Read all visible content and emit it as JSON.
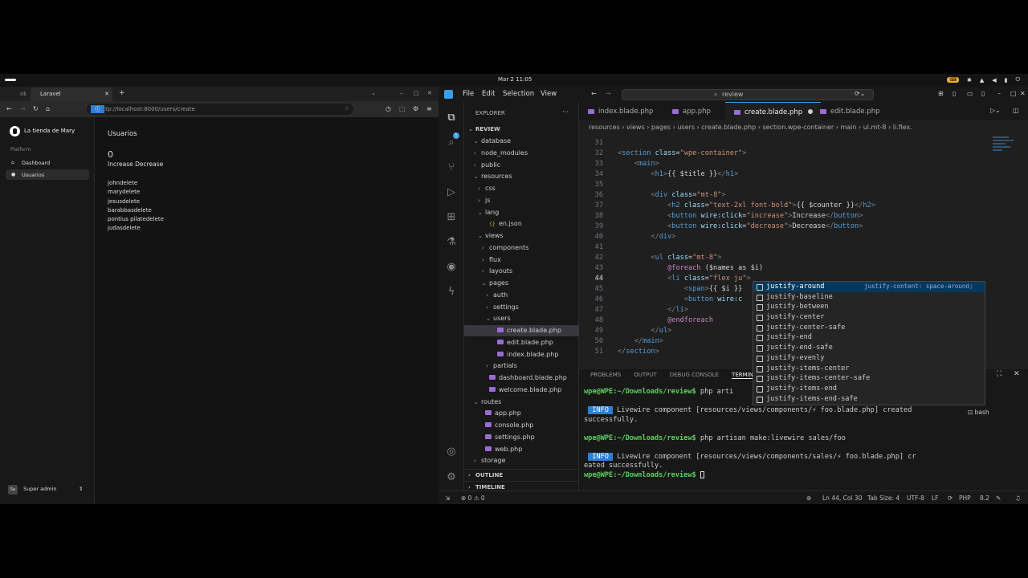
{
  "system": {
    "clock": "Mar 2  11:05"
  },
  "browser": {
    "tab_prev": "ok",
    "tab_title": "Laravel",
    "url": "http://localhost:8000/users/create",
    "app": {
      "brand": "La tienda de Mary",
      "section": "Platform",
      "nav": [
        "Dashboard",
        "Usuarios"
      ],
      "user_initials": "Sa",
      "user_name": "Super admin"
    },
    "content": {
      "title": "Usuarios",
      "counter": "0",
      "buttons": "Increase Decrease",
      "names": [
        "johndelete",
        "marydelete",
        "jesusdelete",
        "barabbasdelete",
        "pontius pilatedelete",
        "judasdelete"
      ]
    }
  },
  "vscode": {
    "menu": [
      "File",
      "Edit",
      "Selection",
      "View"
    ],
    "search": "review",
    "explorer": {
      "header": "EXPLORER",
      "root": "REVIEW",
      "items": [
        {
          "label": "database",
          "arrow": "⌄"
        },
        {
          "label": "node_modules",
          "arrow": "›"
        },
        {
          "label": "public",
          "arrow": "›"
        },
        {
          "label": "resources",
          "arrow": "⌄"
        },
        {
          "label": "css",
          "arrow": "›"
        },
        {
          "label": "js",
          "arrow": "›"
        },
        {
          "label": "lang",
          "arrow": "⌄"
        },
        {
          "label": "en.json",
          "arrow": ""
        },
        {
          "label": "views",
          "arrow": "⌄"
        },
        {
          "label": "components",
          "arrow": "›"
        },
        {
          "label": "flux",
          "arrow": "›"
        },
        {
          "label": "layouts",
          "arrow": "›"
        },
        {
          "label": "pages",
          "arrow": "⌄"
        },
        {
          "label": "auth",
          "arrow": "›"
        },
        {
          "label": "settings",
          "arrow": "›"
        },
        {
          "label": "users",
          "arrow": "⌄"
        },
        {
          "label": "create.blade.php",
          "arrow": ""
        },
        {
          "label": "edit.blade.php",
          "arrow": ""
        },
        {
          "label": "index.blade.php",
          "arrow": ""
        },
        {
          "label": "partials",
          "arrow": "›"
        },
        {
          "label": "dashboard.blade.php",
          "arrow": ""
        },
        {
          "label": "welcome.blade.php",
          "arrow": ""
        },
        {
          "label": "routes",
          "arrow": "⌄"
        },
        {
          "label": "app.php",
          "arrow": ""
        },
        {
          "label": "console.php",
          "arrow": ""
        },
        {
          "label": "settings.php",
          "arrow": ""
        },
        {
          "label": "web.php",
          "arrow": ""
        },
        {
          "label": "storage",
          "arrow": "›"
        }
      ],
      "outline": "OUTLINE",
      "timeline": "TIMELINE"
    },
    "tabs": [
      "index.blade.php",
      "app.php",
      "create.blade.php",
      "edit.blade.php"
    ],
    "breadcrumb": "resources › views › pages › users › create.blade.php › section.wpe-container › main › ul.mt-8 › li.flex.",
    "code": {
      "numbers": [
        "31",
        "32",
        "33",
        "34",
        "35",
        "36",
        "37",
        "38",
        "39",
        "40",
        "41",
        "42",
        "43",
        "44",
        "45",
        "46",
        "47",
        "48",
        "49",
        "50",
        "51"
      ]
    },
    "suggestions": [
      "justify-around",
      "justify-baseline",
      "justify-between",
      "justify-center",
      "justify-center-safe",
      "justify-end",
      "justify-end-safe",
      "justify-evenly",
      "justify-items-center",
      "justify-items-center-safe",
      "justify-items-end",
      "justify-items-end-safe"
    ],
    "suggestion_detail": "justify-content: space-around;",
    "panel_tabs": [
      "PROBLEMS",
      "OUTPUT",
      "DEBUG CONSOLE",
      "TERMINAL"
    ],
    "terminal": {
      "prompt": "wpe@WPE:~/Downloads/review$",
      "cmd1": "php arti",
      "info": "INFO",
      "msg1a": " Livewire component [resources/views/components/⚡ foo.blade.php] created",
      "msg1b": "successfully.",
      "cmd2": "php artisan make:livewire sales/foo",
      "msg2a": " Livewire component [resources/views/components/sales/⚡ foo.blade.php] cr",
      "msg2b": "eated successfully.",
      "shell": "bash"
    },
    "status": {
      "errors": "⊗ 0 ⚠ 0",
      "position": "Ln 44, Col 30",
      "tab_size": "Tab Size: 4",
      "encoding": "UTF-8",
      "eol": "LF",
      "language": "PHP",
      "version": "8.2"
    }
  }
}
